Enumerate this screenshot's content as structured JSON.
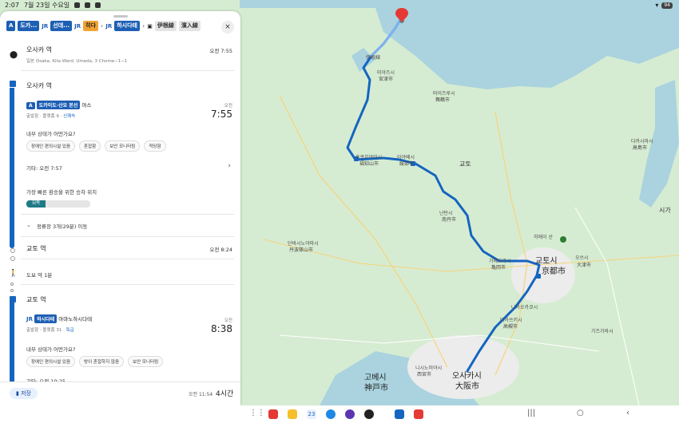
{
  "status": {
    "time": "2:07",
    "date": "7월 23일 수요일",
    "notif_count": "1",
    "battery": "94"
  },
  "header": {
    "chips": [
      "도카...",
      "선데...",
      "히다",
      "하시다테",
      "伊根線",
      "濱入線"
    ],
    "close": "×"
  },
  "origin": {
    "title": "오사카 역",
    "address": "일본 Osaka, Kita Ward, Umeda, 3 Chome−1−1",
    "time": "오전 7:55"
  },
  "leg1": {
    "station": "오사카 역",
    "line": "도카이도·산요 본선",
    "direction": "야스",
    "time_label": "오전",
    "time": "7:55",
    "platform": "출발함 · 플랫폼 9 · ",
    "service": "신쾌속",
    "question": "내부 상태가 어떤가요?",
    "features": [
      "장애인 편의시설 있음",
      "혼잡함",
      "보안 모니터링",
      "적당함"
    ],
    "other": "기타: 오전 7:57",
    "fast_transfer": "가장 빠른 환승을 위한 승차 위치",
    "gauge": "뒤쪽",
    "stops": "정류장 3개(29분) 이동"
  },
  "kyoto": {
    "title": "교토 역",
    "time": "오전 8:24"
  },
  "walk": {
    "text": "도보 약 1분"
  },
  "leg2": {
    "station": "교토 역",
    "line": "하시다테",
    "direction": "아마노하시다테",
    "time_label": "오전",
    "time": "8:38",
    "platform": "출발함 · 플랫폼 31 · ",
    "service": "특급",
    "question": "내부 상태가 어떤가요?",
    "features": [
      "장애인 편의시설 있음",
      "방이 혼잡하지 않음",
      "보안 모니터링"
    ],
    "other": "기타: 오전 10:25"
  },
  "footer": {
    "save": "저장",
    "arrival": "오전 11:54",
    "duration": "4시간"
  },
  "map": {
    "labels": [
      "伊根線",
      "교토",
      "교토시",
      "京都市",
      "오사카시",
      "大阪市",
      "고베시",
      "神戸市",
      "다카쓰키시",
      "高槻市",
      "오쓰시",
      "大津市",
      "히에이 산",
      "나가오카쿄시",
      "기즈가와시",
      "시가",
      "마이즈루시",
      "舞鶴市",
      "후쿠치야마시",
      "福知山市",
      "아야베시",
      "綾部市",
      "미야즈시",
      "宮津市",
      "난탄시",
      "南丹市",
      "가메오카시",
      "亀岡市",
      "단바시노야마시",
      "丹波篠山市",
      "니시노미야시",
      "西宮市",
      "다카시마시",
      "高島市"
    ],
    "route_color": "#1565c0",
    "water_color": "#aad3df",
    "land_color": "#d6ecd2"
  },
  "navbar": {
    "calendar": "23"
  }
}
